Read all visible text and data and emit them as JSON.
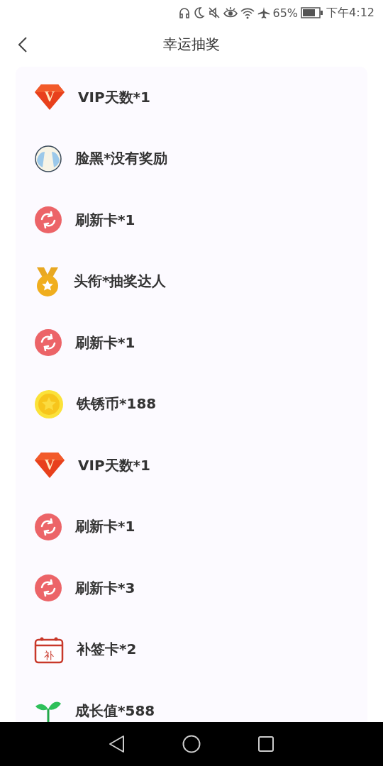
{
  "status_bar": {
    "battery": "65%",
    "time": "下午4:12"
  },
  "header": {
    "title": "幸运抽奖"
  },
  "prizes": [
    {
      "kind": "vip",
      "badge": "V",
      "label": "VIP天数*1"
    },
    {
      "kind": "face",
      "label": "脸黑*没有奖励"
    },
    {
      "kind": "refresh",
      "label": "刷新卡*1"
    },
    {
      "kind": "medal",
      "label": "头衔*抽奖达人"
    },
    {
      "kind": "refresh",
      "label": "刷新卡*1"
    },
    {
      "kind": "coin",
      "label": "铁锈币*188"
    },
    {
      "kind": "vip",
      "badge": "V",
      "label": "VIP天数*1"
    },
    {
      "kind": "refresh",
      "label": "刷新卡*1"
    },
    {
      "kind": "refresh",
      "label": "刷新卡*3"
    },
    {
      "kind": "calendar",
      "badge": "补",
      "label": "补签卡*2"
    },
    {
      "kind": "sprout",
      "label": "成长值*588"
    }
  ]
}
